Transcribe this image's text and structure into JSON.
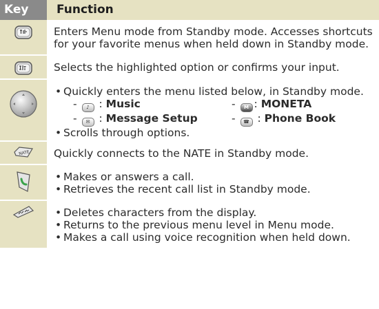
{
  "header": {
    "key": "Key",
    "function": "Function"
  },
  "rows": {
    "menu": {
      "icon": "menu-key-icon",
      "text": "Enters Menu mode from Standby mode. Accesses shortcuts for your favorite menus when held down in Standby mode."
    },
    "confirm": {
      "icon": "confirm-key-icon",
      "text": "Selects the highlighted option or confirms your input."
    },
    "nav": {
      "icon": "navigation-key-icon",
      "bullet1": "Quickly enters the menu listed below, in Standby mode.",
      "items": {
        "music": {
          "dash": "-",
          "sep": ":",
          "label": "Music",
          "icon": "music-key-icon"
        },
        "moneta": {
          "dash": "-",
          "sep": ":",
          "label": "MONETA",
          "icon": "moneta-key-icon"
        },
        "message": {
          "dash": "-",
          "sep": ":",
          "label": "Message Setup",
          "icon": "message-key-icon"
        },
        "phonebook": {
          "dash": "-",
          "sep": ":",
          "label": "Phone Book",
          "icon": "phonebook-key-icon"
        }
      },
      "bullet2": "Scrolls through options."
    },
    "nate": {
      "icon": "nate-key-icon",
      "text": "Quickly connects to the NATE in Standby mode."
    },
    "send": {
      "icon": "send-key-icon",
      "bullet1": "Makes or answers a call.",
      "bullet2": "Retrieves the recent call list in Standby mode."
    },
    "cancel": {
      "icon": "cancel-key-icon",
      "bullet1": "Deletes characters from the display.",
      "bullet2": "Returns to the previous menu level in Menu mode.",
      "bullet3": "Makes a call using voice recognition when held down."
    }
  },
  "bullet_char": "•"
}
